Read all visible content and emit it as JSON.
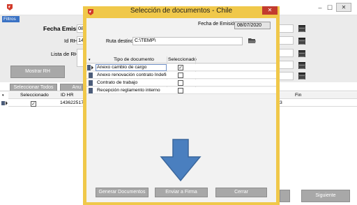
{
  "bg_window": {
    "filters_tab": "Filtros",
    "fecha_emision_label": "Fecha Emisión",
    "fecha_emision_value": "08",
    "id_rh_label": "Id RH",
    "id_rh_value": "14",
    "lista_rhs_label": "Lista de RHs",
    "mostrar_rh_label": "Mostrar RH",
    "seleccionar_todos_label": "Seleccionar Todos",
    "anular_label": "Anu",
    "grid_headers": [
      "Seleccionado",
      "ID HR",
      "Fin"
    ],
    "grid_row": {
      "selected": true,
      "id_hr": "143622517",
      "right_value": "3"
    },
    "siguiente_label": "Siguiente",
    "minimize_glyph": "–",
    "maximize_glyph": "☐",
    "close_glyph": "✕"
  },
  "modal": {
    "title": "Selección de documentos - Chile",
    "close_glyph": "✕",
    "fecha_emision_label": "Fecha de Emisión",
    "fecha_emision_value": "08/07/2020",
    "ruta_destino_label": "Ruta destino:",
    "ruta_destino_value": "C:\\TEMP\\",
    "table": {
      "headers": [
        "Tipo de documento",
        "Seleccionado"
      ],
      "rows": [
        {
          "label": "Anexo cambio de cargo",
          "selected": true
        },
        {
          "label": "Anexo renovación contrato Indefinido",
          "selected": false
        },
        {
          "label": "Contrato de trabajo",
          "selected": false
        },
        {
          "label": "Recepción reglamento interno",
          "selected": false
        }
      ]
    },
    "buttons": {
      "generar": "Generar Documentos",
      "enviar": "Enviar a Firma",
      "cerrar": "Cerrar"
    }
  },
  "colors": {
    "modal_border": "#f0c84a",
    "close_red": "#c23b2e",
    "filters_tab_blue": "#3a72c4",
    "arrow_blue": "#4a7fbf"
  },
  "icons": [
    "app-logo-icon",
    "calendar-icon",
    "folder-icon",
    "document-icon",
    "row-selector-icon",
    "down-arrow-icon"
  ]
}
